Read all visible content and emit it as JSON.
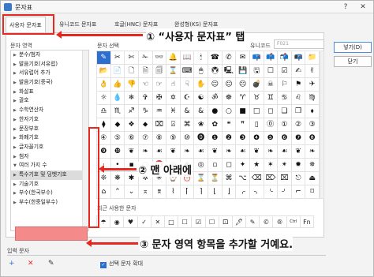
{
  "window": {
    "title": "문자표",
    "help_glyph": "?",
    "close_glyph": "✕"
  },
  "tabs": [
    "사용자 문자표",
    "유니코드 문자표",
    "호글(HNC) 문자표",
    "완성형(KS) 문자표"
  ],
  "left": {
    "header": "문자 영역",
    "items": [
      {
        "label": "분수/첨자",
        "expanded": false
      },
      {
        "label": "발음기호(서유럽)",
        "expanded": false
      },
      {
        "label": "서유럽어 추가",
        "expanded": false
      },
      {
        "label": "발음기호(중국)",
        "expanded": false
      },
      {
        "label": "화살표",
        "expanded": false
      },
      {
        "label": "괄호",
        "expanded": false
      },
      {
        "label": "수학연산자",
        "expanded": false
      },
      {
        "label": "한자기호",
        "expanded": false
      },
      {
        "label": "문장부호",
        "expanded": false
      },
      {
        "label": "화폐기호",
        "expanded": false
      },
      {
        "label": "글자꼴기호",
        "expanded": false
      },
      {
        "label": "첨자",
        "expanded": false
      },
      {
        "label": "여러 가지 수",
        "expanded": true
      },
      {
        "label": "특수기호 및 딩벳기호",
        "expanded": false,
        "selected": true
      },
      {
        "label": "기술기호",
        "expanded": false
      },
      {
        "label": "부수(한국부수)",
        "expanded": false
      },
      {
        "label": "부수(한중일부수)",
        "expanded": false
      }
    ]
  },
  "grid": {
    "header": "문자 선택",
    "unicode_label": "유니코드",
    "unicode_value": "F021",
    "cells": [
      "✎",
      "✂",
      "✄",
      "✁",
      "👓",
      "🔔",
      "📖",
      "🕯",
      "☎",
      "✆",
      "✉",
      "📪",
      "📫",
      "📬",
      "📭",
      "📁",
      "📂",
      "📄",
      "🗋",
      "🗎",
      "🗐",
      "⌛",
      "⌨",
      "🖱",
      "🖲",
      "🖳",
      "💾",
      "🖫",
      "☐",
      "☑",
      "✍",
      "✌",
      "👌",
      "👍",
      "👎",
      "☜",
      "☞",
      "☝",
      "☟",
      "✋",
      "☺",
      "😐",
      "☹",
      "💣",
      "☠",
      "⚐",
      "⚑",
      "✈",
      "☼",
      "💧",
      "❄",
      "✞",
      "✠",
      "✡",
      "☪",
      "☯",
      "ॐ",
      "☸",
      "♈",
      "♉",
      "♊",
      "♋",
      "♌",
      "♍",
      "♎",
      "♏",
      "♐",
      "♑",
      "♒",
      "♓",
      "&",
      "&",
      "●",
      "○",
      "■",
      "□",
      "◻",
      "❑",
      "❒",
      "⬧",
      "⧫",
      "◆",
      "❖",
      "⬥",
      "⌧",
      "⍓",
      "⌘",
      "❀",
      "✿",
      "❝",
      "❞",
      "▯",
      "⓪",
      "①",
      "②",
      "③",
      "④",
      "⑤",
      "⑥",
      "⑦",
      "⑧",
      "⑨",
      "⑩",
      "⓿",
      "❶",
      "❷",
      "❸",
      "❹",
      "❺",
      "❻",
      "❼",
      "❽",
      "❾",
      "❿",
      "❦",
      "❧",
      "☙",
      "❦",
      "❧",
      "☙",
      "❦",
      "❧",
      "☙",
      "❦",
      "❧",
      "☙",
      "❦",
      "❧",
      "·",
      "•",
      "▪",
      "○",
      "⭕",
      "◎",
      "◉",
      "◎",
      "▫",
      "◻",
      "✦",
      "★",
      "✶",
      "✴",
      "✹",
      "✵",
      "❊",
      "❋",
      "✱",
      "✲",
      "✳",
      "⌚",
      "⏰",
      "⌛",
      "⏳",
      "⌘",
      "⌥",
      "⌫",
      "⌦",
      "⌧",
      "⎋",
      "⏏",
      "⌂",
      "⌃",
      "⌄",
      "⌅",
      "⌆",
      "⌇",
      "⌈",
      "⌉",
      "⌊",
      "⌋",
      "⌌",
      "⌍",
      "⌎",
      "⌏",
      "⌐",
      "⌑"
    ],
    "selected_index": 0
  },
  "recent": {
    "label": "최근 사용한 문자",
    "cells": [
      "☂",
      "◉",
      "♥",
      "✓",
      "✕",
      "□",
      "☐",
      "☑",
      "☐",
      "⚀",
      "🖊",
      "✎",
      "©",
      "®",
      "Ctrl",
      "Fn"
    ]
  },
  "input": {
    "label": "입력 문자",
    "expand_label": "선택 문자 확대",
    "add_glyph": "+",
    "remove_glyph": "✕",
    "edit_glyph": "✎",
    "check_glyph": "✓"
  },
  "buttons": {
    "insert": "넣기(D)",
    "close": "닫기"
  },
  "annotations": {
    "a1": "① “사용자 문자표” 탭",
    "a2": "② 맨 아래에",
    "a3": "③ 문자 영역 항목을 추가할 거예요."
  },
  "colors": {
    "highlight_red": "#e6281e",
    "add_box": "#f58a8a",
    "accent_blue": "#2d6fcf"
  }
}
